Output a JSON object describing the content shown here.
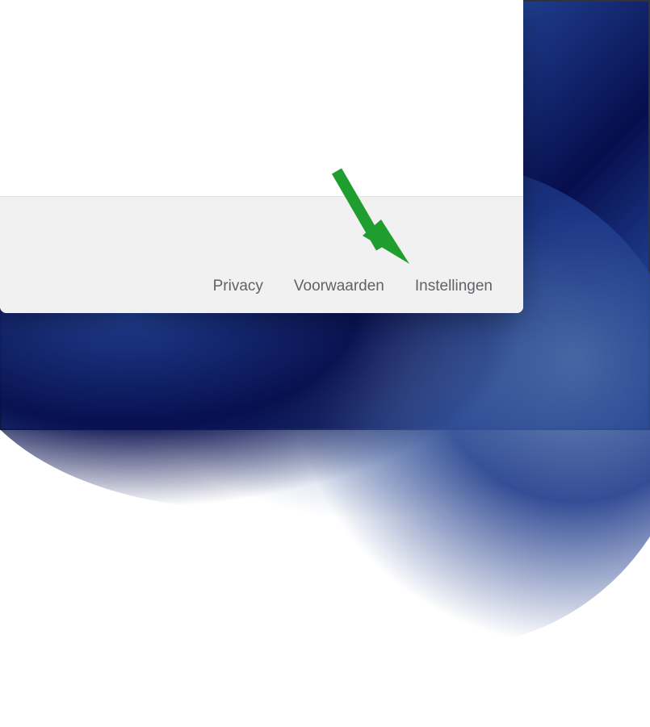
{
  "footer": {
    "links": [
      {
        "label": "Privacy"
      },
      {
        "label": "Voorwaarden"
      },
      {
        "label": "Instellingen"
      }
    ]
  },
  "annotation": {
    "arrow_color": "#1f9e2f"
  }
}
